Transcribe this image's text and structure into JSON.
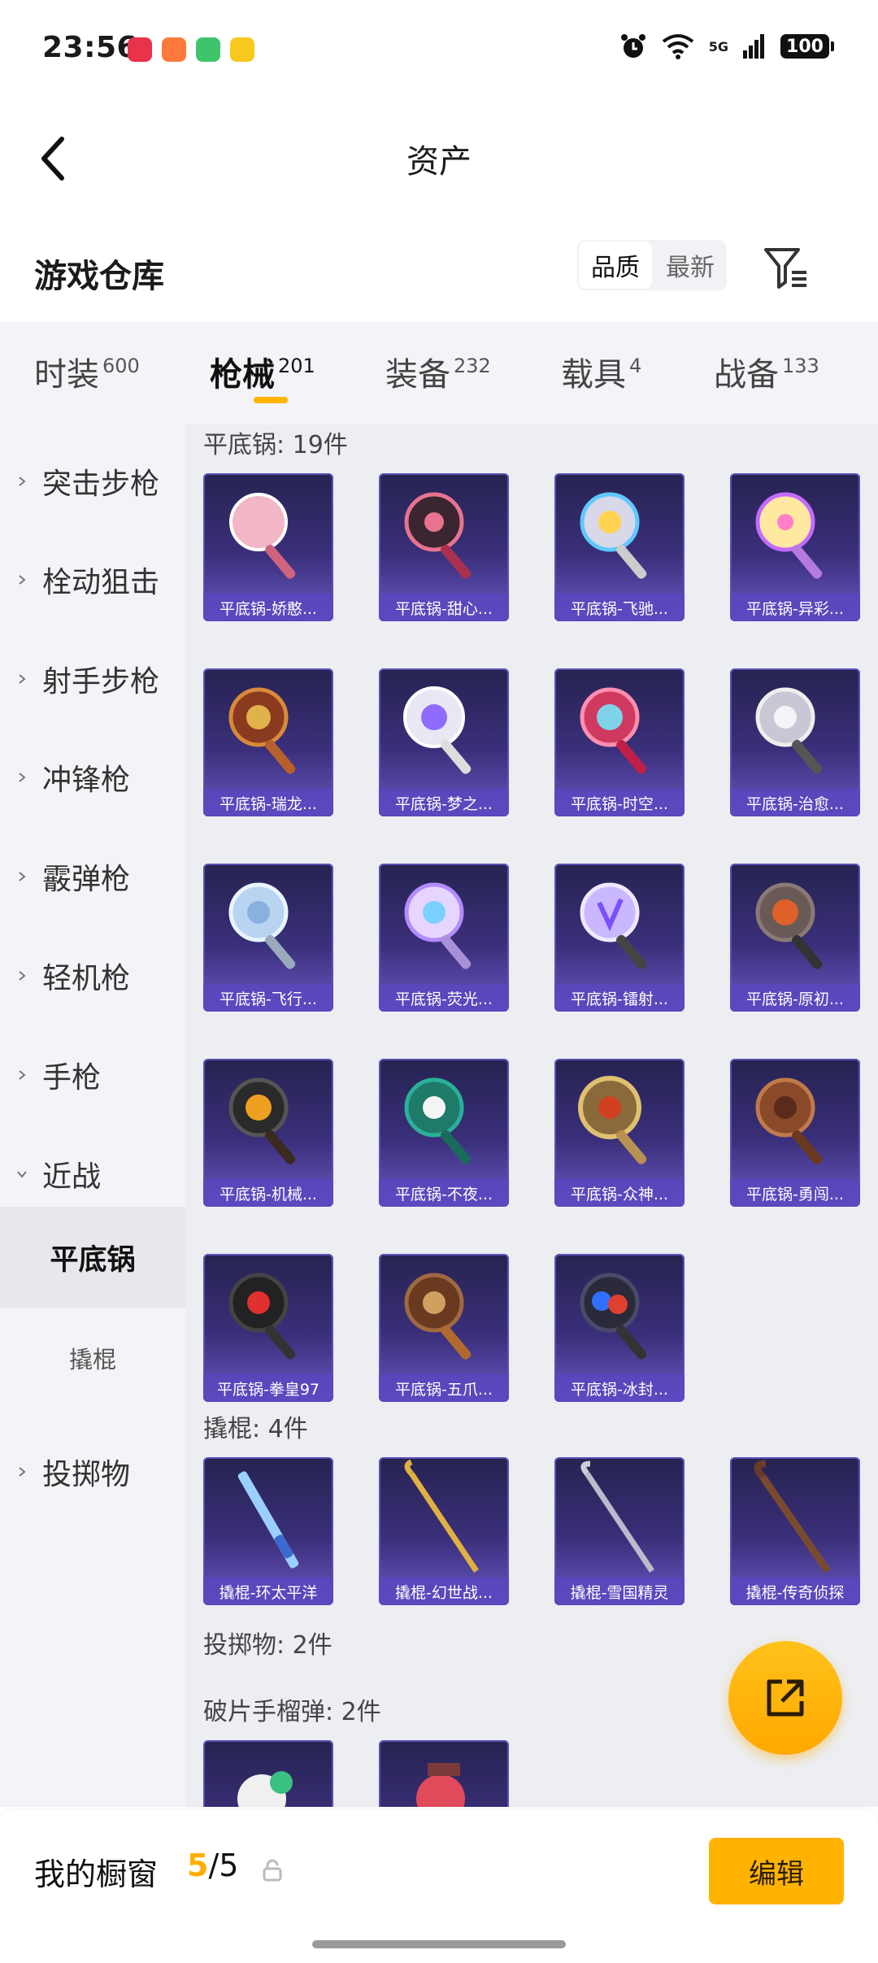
{
  "status_bar": {
    "time": "23:56",
    "network": "5G",
    "battery": "100",
    "app_icons": [
      "pdd-app-icon",
      "game-app-icon",
      "grid-app-icon",
      "seven-app-icon"
    ]
  },
  "header": {
    "title": "资产"
  },
  "section": {
    "title": "游戏仓库",
    "sort_options": [
      {
        "label": "品质",
        "active": true
      },
      {
        "label": "最新",
        "active": false
      }
    ]
  },
  "tabs": [
    {
      "label": "时装",
      "count": "600",
      "active": false
    },
    {
      "label": "枪械",
      "count": "201",
      "active": true
    },
    {
      "label": "装备",
      "count": "232",
      "active": false
    },
    {
      "label": "载具",
      "count": "4",
      "active": false
    },
    {
      "label": "战备",
      "count": "133",
      "active": false
    }
  ],
  "sidebar": {
    "items": [
      {
        "label": "突击步枪",
        "expanded": false
      },
      {
        "label": "栓动狙击",
        "expanded": false
      },
      {
        "label": "射手步枪",
        "expanded": false
      },
      {
        "label": "冲锋枪",
        "expanded": false
      },
      {
        "label": "霰弹枪",
        "expanded": false
      },
      {
        "label": "轻机枪",
        "expanded": false
      },
      {
        "label": "手枪",
        "expanded": false
      },
      {
        "label": "近战",
        "expanded": true
      }
    ],
    "subitems": [
      {
        "label": "平底锅",
        "active": true
      },
      {
        "label": "撬棍",
        "active": false
      }
    ],
    "last_item": {
      "label": "投掷物",
      "expanded": false
    }
  },
  "groups": [
    {
      "title": "平底锅: 19件",
      "items": [
        "平底锅-娇憨...",
        "平底锅-甜心...",
        "平底锅-飞驰...",
        "平底锅-异彩...",
        "平底锅-瑞龙...",
        "平底锅-梦之...",
        "平底锅-时空...",
        "平底锅-治愈...",
        "平底锅-飞行...",
        "平底锅-荧光...",
        "平底锅-镭射...",
        "平底锅-原初...",
        "平底锅-机械...",
        "平底锅-不夜...",
        "平底锅-众神...",
        "平底锅-勇闯...",
        "平底锅-拳皇97",
        "平底锅-五爪...",
        "平底锅-冰封..."
      ]
    },
    {
      "title": "撬棍: 4件",
      "items": [
        "撬棍-环太平洋",
        "撬棍-幻世战...",
        "撬棍-雪国精灵",
        "撬棍-传奇侦探"
      ]
    },
    {
      "title": "投掷物: 2件",
      "items": []
    },
    {
      "title": "破片手榴弹: 2件",
      "items": [
        "",
        ""
      ]
    }
  ],
  "fab": {
    "icon": "share-out-icon"
  },
  "bottom_bar": {
    "label": "我的橱窗",
    "current": "5",
    "separator": "/",
    "max": "5",
    "edit_label": "编辑"
  },
  "colors": {
    "accent": "#ffb400",
    "card_bg_top": "#262350",
    "card_bg_bottom": "#6a58c4"
  }
}
